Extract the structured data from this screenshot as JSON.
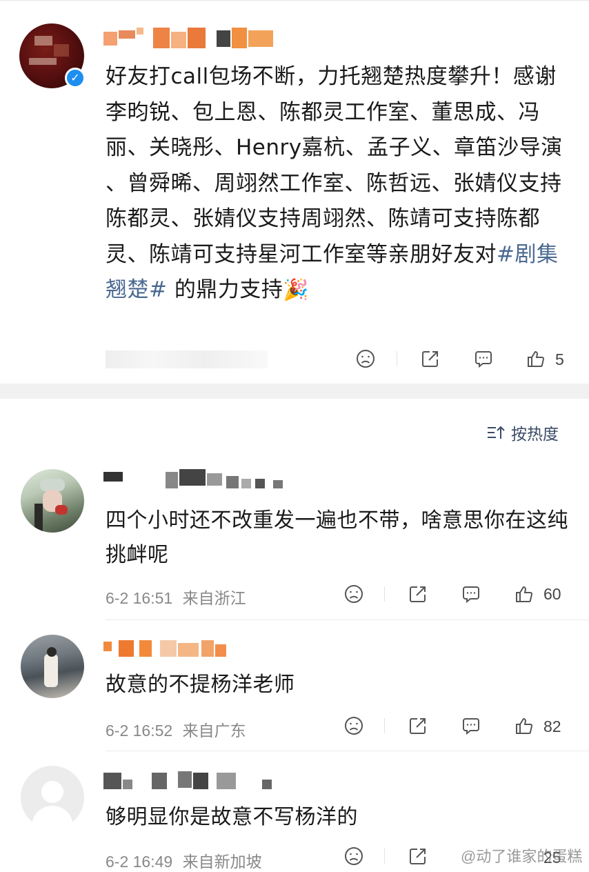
{
  "post": {
    "text_main": "好友打call包场不断，力托翘楚热度攀升！感谢李昀锐、包上恩、陈都灵工作室、董思成、冯丽、关晓彤、Henry嘉杭、孟子义、章笛沙导演 、曾舜晞、周翊然工作室、陈哲远、张婧仪支持陈都灵、张婧仪支持周翊然、陈靖可支持陈都灵、陈靖可支持星河工作室等亲朋好友对",
    "hashtag": "#剧集翘楚#",
    "text_tail": " 的鼎力支持",
    "emoji": "🎉",
    "like_count": "5"
  },
  "sort": {
    "label": "按热度"
  },
  "comments": [
    {
      "text": "四个小时还不改重发一遍也不带，啥意思你在这纯挑衅呢",
      "time": "6-2 16:51",
      "location": "来自浙江",
      "like_count": "60"
    },
    {
      "text": "故意的不提杨洋老师",
      "time": "6-2 16:52",
      "location": "来自广东",
      "like_count": "82"
    },
    {
      "text": "够明显你是故意不写杨洋的",
      "time": "6-2 16:49",
      "location": "来自新加坡",
      "like_count": "25"
    }
  ],
  "watermark": "@动了谁家的蛋糕",
  "colors": {
    "hashtag": "#4a6890",
    "verified": "#1d8ff0",
    "sort_text": "#3b4a66"
  },
  "icons": [
    "sad-face-icon",
    "share-icon",
    "comment-icon",
    "like-icon",
    "sort-icon",
    "verified-icon"
  ]
}
